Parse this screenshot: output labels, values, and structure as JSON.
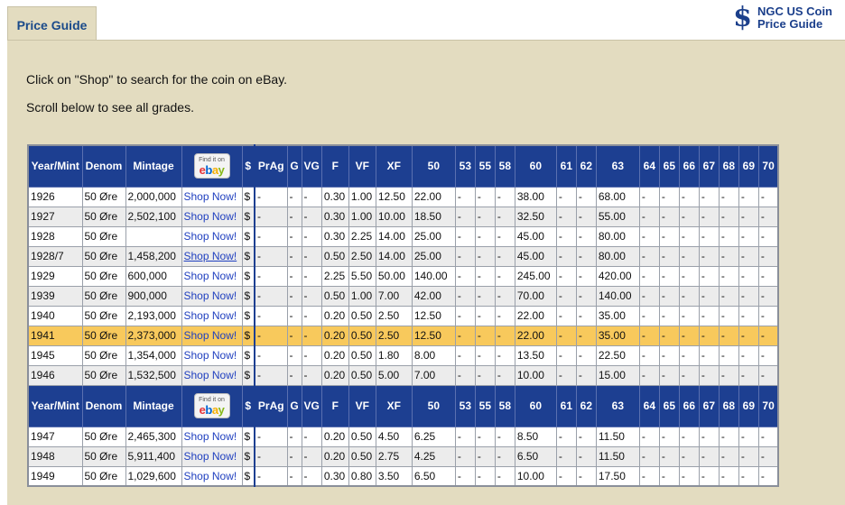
{
  "tab": {
    "label": "Price Guide"
  },
  "logo": {
    "symbol": "$",
    "line1": "NGC US Coin",
    "line2": "Price Guide"
  },
  "intro": {
    "line1": "Click on \"Shop\" to search for the coin on eBay.",
    "line2": "Scroll below to see all grades."
  },
  "ebay": {
    "small": "Find it on",
    "e": "e",
    "b": "b",
    "a": "a",
    "y": "y"
  },
  "headers": [
    "Year/Mint",
    "Denom",
    "Mintage",
    "",
    "$",
    "PrAg",
    "G",
    "VG",
    "F",
    "VF",
    "XF",
    "50",
    "53",
    "55",
    "58",
    "60",
    "61",
    "62",
    "63",
    "64",
    "65",
    "66",
    "67",
    "68",
    "69",
    "70"
  ],
  "rows_a": [
    {
      "year": "1926",
      "denom": "50 Øre",
      "mintage": "2,000,000",
      "shop": "Shop Now!",
      "d": "$",
      "prag": "-",
      "g": "-",
      "vg": "-",
      "f": "0.30",
      "vf": "1.00",
      "xf": "12.50",
      "g50": "22.00",
      "g53": "-",
      "g55": "-",
      "g58": "-",
      "g60": "38.00",
      "g61": "-",
      "g62": "-",
      "g63": "68.00",
      "g64": "-",
      "g65": "-",
      "g66": "-",
      "g67": "-",
      "g68": "-",
      "g69": "-",
      "g70": "-"
    },
    {
      "year": "1927",
      "denom": "50 Øre",
      "mintage": "2,502,100",
      "shop": "Shop Now!",
      "d": "$",
      "prag": "-",
      "g": "-",
      "vg": "-",
      "f": "0.30",
      "vf": "1.00",
      "xf": "10.00",
      "g50": "18.50",
      "g53": "-",
      "g55": "-",
      "g58": "-",
      "g60": "32.50",
      "g61": "-",
      "g62": "-",
      "g63": "55.00",
      "g64": "-",
      "g65": "-",
      "g66": "-",
      "g67": "-",
      "g68": "-",
      "g69": "-",
      "g70": "-"
    },
    {
      "year": "1928",
      "denom": "50 Øre",
      "mintage": "",
      "shop": "Shop Now!",
      "d": "$",
      "prag": "-",
      "g": "-",
      "vg": "-",
      "f": "0.30",
      "vf": "2.25",
      "xf": "14.00",
      "g50": "25.00",
      "g53": "-",
      "g55": "-",
      "g58": "-",
      "g60": "45.00",
      "g61": "-",
      "g62": "-",
      "g63": "80.00",
      "g64": "-",
      "g65": "-",
      "g66": "-",
      "g67": "-",
      "g68": "-",
      "g69": "-",
      "g70": "-"
    },
    {
      "year": "1928/7",
      "denom": "50 Øre",
      "mintage": "1,458,200",
      "shop": "Shop Now!",
      "d": "$",
      "prag": "-",
      "g": "-",
      "vg": "-",
      "f": "0.50",
      "vf": "2.50",
      "xf": "14.00",
      "g50": "25.00",
      "g53": "-",
      "g55": "-",
      "g58": "-",
      "g60": "45.00",
      "g61": "-",
      "g62": "-",
      "g63": "80.00",
      "g64": "-",
      "g65": "-",
      "g66": "-",
      "g67": "-",
      "g68": "-",
      "g69": "-",
      "g70": "-"
    },
    {
      "year": "1929",
      "denom": "50 Øre",
      "mintage": "600,000",
      "shop": "Shop Now!",
      "d": "$",
      "prag": "-",
      "g": "-",
      "vg": "-",
      "f": "2.25",
      "vf": "5.50",
      "xf": "50.00",
      "g50": "140.00",
      "g53": "-",
      "g55": "-",
      "g58": "-",
      "g60": "245.00",
      "g61": "-",
      "g62": "-",
      "g63": "420.00",
      "g64": "-",
      "g65": "-",
      "g66": "-",
      "g67": "-",
      "g68": "-",
      "g69": "-",
      "g70": "-"
    },
    {
      "year": "1939",
      "denom": "50 Øre",
      "mintage": "900,000",
      "shop": "Shop Now!",
      "d": "$",
      "prag": "-",
      "g": "-",
      "vg": "-",
      "f": "0.50",
      "vf": "1.00",
      "xf": "7.00",
      "g50": "42.00",
      "g53": "-",
      "g55": "-",
      "g58": "-",
      "g60": "70.00",
      "g61": "-",
      "g62": "-",
      "g63": "140.00",
      "g64": "-",
      "g65": "-",
      "g66": "-",
      "g67": "-",
      "g68": "-",
      "g69": "-",
      "g70": "-"
    },
    {
      "year": "1940",
      "denom": "50 Øre",
      "mintage": "2,193,000",
      "shop": "Shop Now!",
      "d": "$",
      "prag": "-",
      "g": "-",
      "vg": "-",
      "f": "0.20",
      "vf": "0.50",
      "xf": "2.50",
      "g50": "12.50",
      "g53": "-",
      "g55": "-",
      "g58": "-",
      "g60": "22.00",
      "g61": "-",
      "g62": "-",
      "g63": "35.00",
      "g64": "-",
      "g65": "-",
      "g66": "-",
      "g67": "-",
      "g68": "-",
      "g69": "-",
      "g70": "-"
    },
    {
      "year": "1941",
      "denom": "50 Øre",
      "mintage": "2,373,000",
      "shop": "Shop Now!",
      "d": "$",
      "prag": "-",
      "g": "-",
      "vg": "-",
      "f": "0.20",
      "vf": "0.50",
      "xf": "2.50",
      "g50": "12.50",
      "g53": "-",
      "g55": "-",
      "g58": "-",
      "g60": "22.00",
      "g61": "-",
      "g62": "-",
      "g63": "35.00",
      "g64": "-",
      "g65": "-",
      "g66": "-",
      "g67": "-",
      "g68": "-",
      "g69": "-",
      "g70": "-"
    },
    {
      "year": "1945",
      "denom": "50 Øre",
      "mintage": "1,354,000",
      "shop": "Shop Now!",
      "d": "$",
      "prag": "-",
      "g": "-",
      "vg": "-",
      "f": "0.20",
      "vf": "0.50",
      "xf": "1.80",
      "g50": "8.00",
      "g53": "-",
      "g55": "-",
      "g58": "-",
      "g60": "13.50",
      "g61": "-",
      "g62": "-",
      "g63": "22.50",
      "g64": "-",
      "g65": "-",
      "g66": "-",
      "g67": "-",
      "g68": "-",
      "g69": "-",
      "g70": "-"
    },
    {
      "year": "1946",
      "denom": "50 Øre",
      "mintage": "1,532,500",
      "shop": "Shop Now!",
      "d": "$",
      "prag": "-",
      "g": "-",
      "vg": "-",
      "f": "0.20",
      "vf": "0.50",
      "xf": "5.00",
      "g50": "7.00",
      "g53": "-",
      "g55": "-",
      "g58": "-",
      "g60": "10.00",
      "g61": "-",
      "g62": "-",
      "g63": "15.00",
      "g64": "-",
      "g65": "-",
      "g66": "-",
      "g67": "-",
      "g68": "-",
      "g69": "-",
      "g70": "-"
    }
  ],
  "rows_b": [
    {
      "year": "1947",
      "denom": "50 Øre",
      "mintage": "2,465,300",
      "shop": "Shop Now!",
      "d": "$",
      "prag": "-",
      "g": "-",
      "vg": "-",
      "f": "0.20",
      "vf": "0.50",
      "xf": "4.50",
      "g50": "6.25",
      "g53": "-",
      "g55": "-",
      "g58": "-",
      "g60": "8.50",
      "g61": "-",
      "g62": "-",
      "g63": "11.50",
      "g64": "-",
      "g65": "-",
      "g66": "-",
      "g67": "-",
      "g68": "-",
      "g69": "-",
      "g70": "-"
    },
    {
      "year": "1948",
      "denom": "50 Øre",
      "mintage": "5,911,400",
      "shop": "Shop Now!",
      "d": "$",
      "prag": "-",
      "g": "-",
      "vg": "-",
      "f": "0.20",
      "vf": "0.50",
      "xf": "2.75",
      "g50": "4.25",
      "g53": "-",
      "g55": "-",
      "g58": "-",
      "g60": "6.50",
      "g61": "-",
      "g62": "-",
      "g63": "11.50",
      "g64": "-",
      "g65": "-",
      "g66": "-",
      "g67": "-",
      "g68": "-",
      "g69": "-",
      "g70": "-"
    },
    {
      "year": "1949",
      "denom": "50 Øre",
      "mintage": "1,029,600",
      "shop": "Shop Now!",
      "d": "$",
      "prag": "-",
      "g": "-",
      "vg": "-",
      "f": "0.30",
      "vf": "0.80",
      "xf": "3.50",
      "g50": "6.50",
      "g53": "-",
      "g55": "-",
      "g58": "-",
      "g60": "10.00",
      "g61": "-",
      "g62": "-",
      "g63": "17.50",
      "g64": "-",
      "g65": "-",
      "g66": "-",
      "g67": "-",
      "g68": "-",
      "g69": "-",
      "g70": "-"
    }
  ],
  "highlight_year": "1941",
  "underlined_shop_year": "1928/7"
}
